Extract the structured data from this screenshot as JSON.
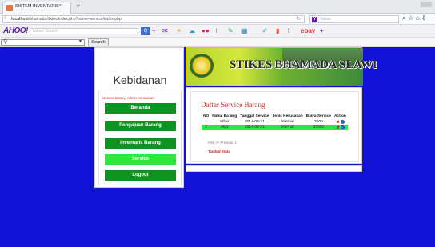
{
  "browser": {
    "tab_title": "SISTEM INVENTARIS",
    "tab_close": "×",
    "new_tab": "+",
    "url_host": "localhost",
    "url_path": "/bhamada/ibdev/index.php?name=service/index.php",
    "yahoo_search_placeholder": "Yahoo",
    "yahoo_y": "Y"
  },
  "yahoo_toolbar": {
    "logo": "AHOO!",
    "search_placeholder": "Yahoo! Search",
    "search_button": "Q",
    "ebay": "ebay",
    "plus": "+"
  },
  "search_row": {
    "button_label": "Search"
  },
  "sidebar": {
    "brand": "Kebidanan",
    "welcome": "Selamat Datang Admin Kebidanan -",
    "menu": [
      {
        "label": "Beranda"
      },
      {
        "label": "Pengajuan Barang"
      },
      {
        "label": "Inventaris Barang"
      },
      {
        "label": "Service"
      },
      {
        "label": "Logout"
      }
    ]
  },
  "header": {
    "title": "STIKES BHAMADA SLAWI"
  },
  "main": {
    "title": "Daftar Service Barang",
    "columns": [
      "NO",
      "Nama Barang",
      "Tanggal Service",
      "Jenis Kerusakan",
      "Biaya Service",
      "Action"
    ],
    "rows": [
      [
        "1",
        "tirfue",
        "2014-08-21",
        "internal",
        "7000"
      ],
      [
        "2",
        "ekja",
        "2014-08-21",
        "internal",
        "30000"
      ]
    ],
    "pager": "First | < Previous 1",
    "add_link": "Tambah Data",
    "colors": {
      "title": "#c9302c",
      "menu": "#0d9420",
      "active": "#2de83c",
      "background": "#1111d8"
    }
  }
}
